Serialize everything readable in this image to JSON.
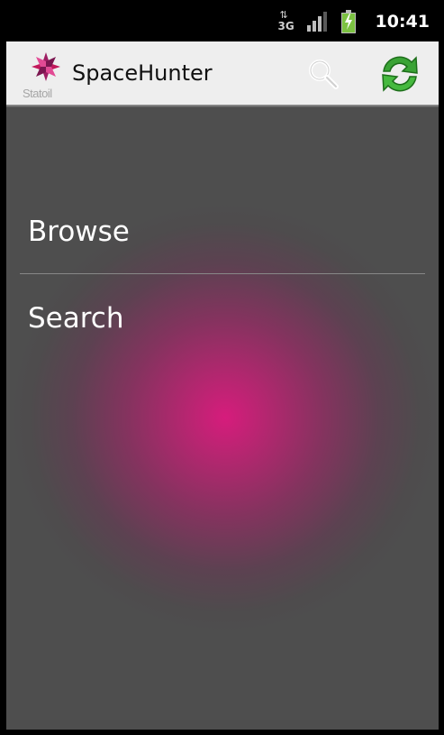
{
  "status_bar": {
    "network_label": "3G",
    "network_arrows": "⇅",
    "time": "10:41",
    "signal_bars": 4,
    "signal_strength": 3,
    "battery_charging": true,
    "battery_color": "#7cc242"
  },
  "action_bar": {
    "logo_text": "Statoil",
    "title": "SpaceHunter",
    "actions": [
      {
        "name": "search",
        "icon": "search-icon"
      },
      {
        "name": "refresh",
        "icon": "refresh-icon"
      }
    ]
  },
  "menu": {
    "items": [
      {
        "label": "Browse"
      },
      {
        "label": "Search"
      }
    ]
  },
  "colors": {
    "background": "#4e4e4e",
    "accent_glow": "#d61c7c",
    "action_bar": "#eeeeee",
    "refresh_green": "#3aa335"
  }
}
